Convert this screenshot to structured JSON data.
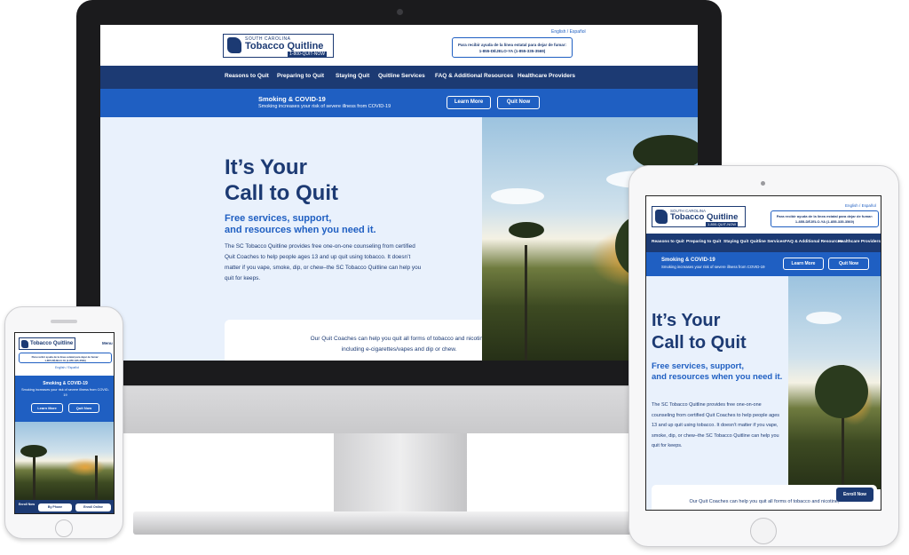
{
  "site": {
    "logo_state": "SOUTH CAROLINA",
    "logo_name": "Tobacco Quitline",
    "logo_tag": "QUIT·NOW",
    "logo_number": "1-800-QUIT-NOW",
    "lang_english": "English",
    "lang_sep": "/",
    "lang_spanish": "Español",
    "spanish_help_line1": "Para recibir ayuda de la línea estatal para dejar de fumar:",
    "spanish_help_line2": "1-855-DÉJELO-YA (1-855-335-3569)",
    "nav": [
      "Reasons to Quit",
      "Preparing to Quit",
      "Staying Quit",
      "Quitline Services",
      "FAQ & Additional Resources",
      "Healthcare Providers"
    ],
    "covid_title": "Smoking & COVID-19",
    "covid_sub": "Smoking increases your risk of severe illness from COVID-19",
    "learn_more": "Learn More",
    "quit_now": "Quit Now",
    "hero_title_1": "It’s Your",
    "hero_title_2": "Call to Quit",
    "hero_sub_1": "Free services, support,",
    "hero_sub_2": "and resources when you need it.",
    "hero_body": "The SC Tobacco Quitline provides free one-on-one counseling from certified Quit Coaches to help people ages 13 and up quit using tobacco. It doesn’t matter if you vape, smoke, dip, or chew–the SC Tobacco Quitline can help you quit for keeps.",
    "coaches_1": "Our Quit Coaches can help you quit all forms of tobacco and nicotine,",
    "coaches_2": "including e-cigarettes/vapes and dip or chew.",
    "enroll_now": "Enroll Now",
    "menu": "Menu",
    "phone_enroll": "Enroll Now",
    "by_phone": "By Phone",
    "enroll_online": "Enroll Online"
  },
  "colors": {
    "navy": "#1c3a73",
    "blue": "#1f5fc2",
    "hero": "#e9f1fc"
  }
}
